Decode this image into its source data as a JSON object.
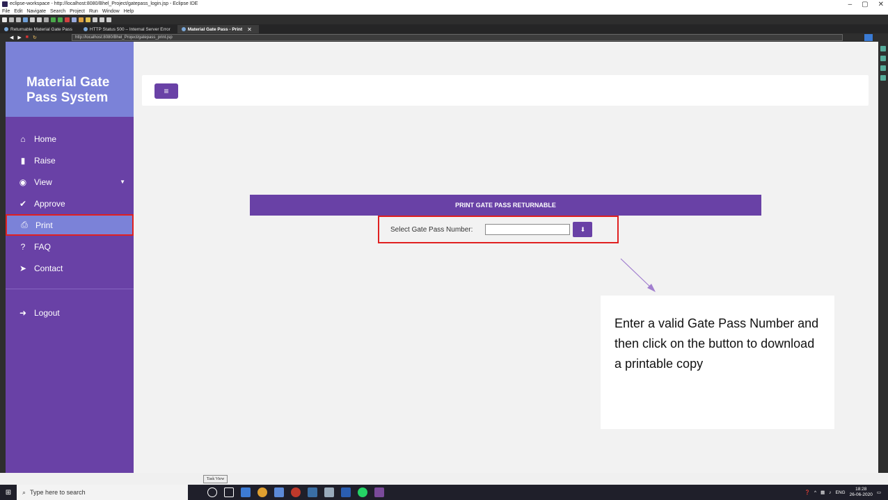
{
  "window": {
    "title": "eclipse-workspace - http://localhost:8080/Bhel_Project/gatepass_login.jsp - Eclipse IDE",
    "controls": [
      "–",
      "▢",
      "✕"
    ]
  },
  "menubar": [
    "File",
    "Edit",
    "Navigate",
    "Search",
    "Project",
    "Run",
    "Window",
    "Help"
  ],
  "tabs": [
    {
      "label": "Returnable Material Gate Pass"
    },
    {
      "label": "HTTP Status 500 – Internal Server Error"
    },
    {
      "label": "Material Gate Pass - Print",
      "active": true,
      "close": "✕"
    }
  ],
  "browser": {
    "url": "http://localhost:8080/Bhel_Project/gatepass_print.jsp"
  },
  "sidebar": {
    "brand": "Material Gate Pass System",
    "items": [
      {
        "label": "Home",
        "icon": "home-icon",
        "glyph": "⌂"
      },
      {
        "label": "Raise",
        "icon": "file-icon",
        "glyph": "▮"
      },
      {
        "label": "View",
        "icon": "eye-icon",
        "glyph": "◉",
        "caret": "▼"
      },
      {
        "label": "Approve",
        "icon": "check-icon",
        "glyph": "✔"
      },
      {
        "label": "Print",
        "icon": "print-icon",
        "glyph": "⎙",
        "active": true
      },
      {
        "label": "FAQ",
        "icon": "question-icon",
        "glyph": "?"
      },
      {
        "label": "Contact",
        "icon": "send-icon",
        "glyph": "➤"
      }
    ],
    "logout": {
      "label": "Logout",
      "icon": "logout-icon",
      "glyph": "➜"
    }
  },
  "topnav": {
    "menu_glyph": "≡"
  },
  "print": {
    "heading": "PRINT GATE PASS RETURNABLE",
    "select_label": "Select Gate Pass Number:",
    "input_value": "",
    "download_glyph": "⬇"
  },
  "callout": {
    "text": "Enter a valid Gate Pass Number and then click on the button to download a printable copy"
  },
  "tooltip": "Task View",
  "taskbar": {
    "search_placeholder": "Type here to search",
    "lang": "ENG",
    "time": "18:28",
    "date": "26-06-2020"
  },
  "colors": {
    "sidebar": "#6941a6",
    "brand": "#7b82d8",
    "highlight": "#e02020"
  }
}
